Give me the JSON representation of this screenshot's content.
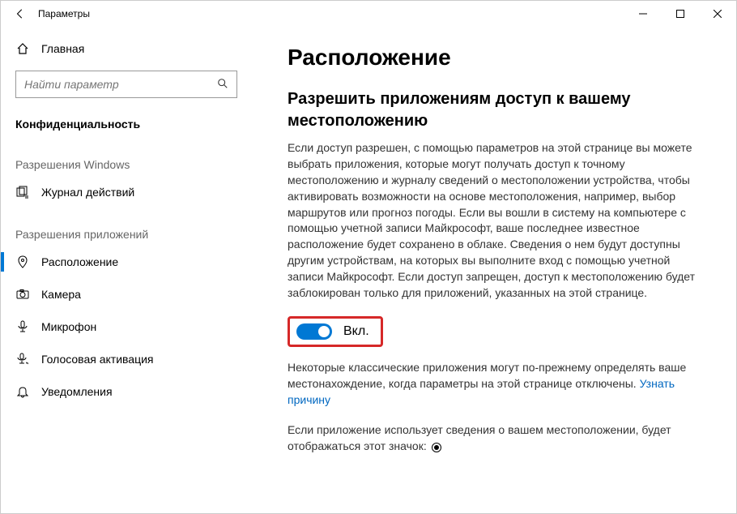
{
  "titlebar": {
    "title": "Параметры"
  },
  "sidebar": {
    "home": "Главная",
    "search_placeholder": "Найти параметр",
    "current_section": "Конфиденциальность",
    "group1": "Разрешения Windows",
    "group2": "Разрешения приложений",
    "items": {
      "history": "Журнал действий",
      "location": "Расположение",
      "camera": "Камера",
      "microphone": "Микрофон",
      "voice": "Голосовая активация",
      "notifications": "Уведомления"
    }
  },
  "content": {
    "h1": "Расположение",
    "h2": "Разрешить приложениям доступ к вашему местоположению",
    "p1": "Если доступ разрешен, с помощью параметров на этой странице вы можете выбрать приложения, которые могут получать доступ к точному местоположению и журналу сведений о местоположении устройства, чтобы активировать возможности на основе местоположения, например, выбор маршрутов или прогноз погоды. Если вы вошли в систему на компьютере с помощью учетной записи Майкрософт, ваше последнее известное расположение будет сохранено в облаке. Сведения о нем будут доступны другим устройствам, на которых вы выполните вход с помощью учетной записи Майкрософт. Если доступ запрещен, доступ к местоположению будет заблокирован только для приложений, указанных на этой странице.",
    "toggle_label": "Вкл.",
    "p2_a": "Некоторые классические приложения могут по-прежнему определять ваше местонахождение, когда параметры на этой странице отключены. ",
    "p2_link": "Узнать причину",
    "p3": "Если приложение использует сведения о вашем местоположении, будет отображаться этот значок: "
  }
}
